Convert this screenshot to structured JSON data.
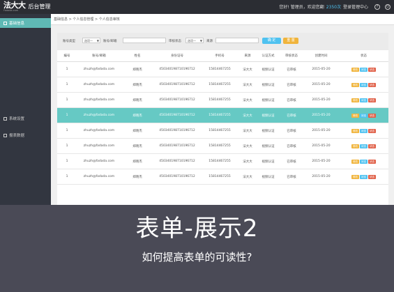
{
  "topbar": {
    "logo": "法大大",
    "logo_sub": "Fadada.com",
    "app_title": "后台管理",
    "greeting": "您好! 管理员，欢迎您翻",
    "price": "2350次",
    "user_center": "登录管理中心",
    "help_icon": "?",
    "power_icon": "⏻"
  },
  "sidebar": {
    "items": [
      {
        "label": "基础信息",
        "icon": "grid-icon"
      },
      {
        "label": "系统设置",
        "icon": "monitor-icon"
      },
      {
        "label": "报表数据",
        "icon": "chart-icon"
      }
    ]
  },
  "breadcrumb": "基础信息 > 个人信息管理 > 个人信息审核",
  "filters": {
    "account_type_label": "账号类型",
    "account_type_value": "选项一",
    "account_email_label": "账号/邮箱",
    "audit_status_label": "审核状态",
    "audit_status_value": "选项一",
    "source_label": "来源",
    "query_btn": "确 定",
    "reset_btn": "重 置"
  },
  "table": {
    "headers": [
      "编号",
      "账号/邮箱",
      "姓名",
      "身份证号",
      "手机号",
      "来源",
      "认证方式",
      "审核状态",
      "创建时间",
      "状态"
    ],
    "rows": [
      [
        "1",
        "zhuzh@fadada.com",
        "郑晓杰",
        "450340198710196712",
        "15814467255",
        "法大大",
        "视频认证",
        "已审核",
        "2015-05-20"
      ],
      [
        "1",
        "zhuzh@fadada.com",
        "郑晓杰",
        "450340198710196712",
        "15814467255",
        "法大大",
        "视频认证",
        "已审核",
        "2015-05-20"
      ],
      [
        "1",
        "zhuzh@fadada.com",
        "郑晓杰",
        "450340198710196712",
        "15814467255",
        "法大大",
        "视频认证",
        "已审核",
        "2015-05-20"
      ],
      [
        "1",
        "zhuzh@fadada.com",
        "郑晓杰",
        "450340198710196712",
        "15814467255",
        "法大大",
        "视频认证",
        "已审核",
        "2015-05-20"
      ],
      [
        "1",
        "zhuzh@fadada.com",
        "郑晓杰",
        "450340198710196712",
        "15814467255",
        "法大大",
        "视频认证",
        "已审核",
        "2015-05-20"
      ],
      [
        "1",
        "zhuzh@fadada.com",
        "郑晓杰",
        "450340198710196712",
        "15814467255",
        "法大大",
        "视频认证",
        "已审核",
        "2015-05-20"
      ],
      [
        "1",
        "zhuzh@fadada.com",
        "郑晓杰",
        "450340198710196712",
        "15814467255",
        "法大大",
        "视频认证",
        "已审核",
        "2015-05-20"
      ],
      [
        "1",
        "zhuzh@fadada.com",
        "郑晓杰",
        "450340198710196712",
        "15814467255",
        "法大大",
        "视频认证",
        "已审核",
        "2015-05-20"
      ]
    ],
    "highlight_row": 3,
    "actions": [
      "修改",
      "状态",
      "状态"
    ]
  },
  "overlay": {
    "title": "表单-展示2",
    "subtitle": "如何提高表单的可读性?"
  }
}
